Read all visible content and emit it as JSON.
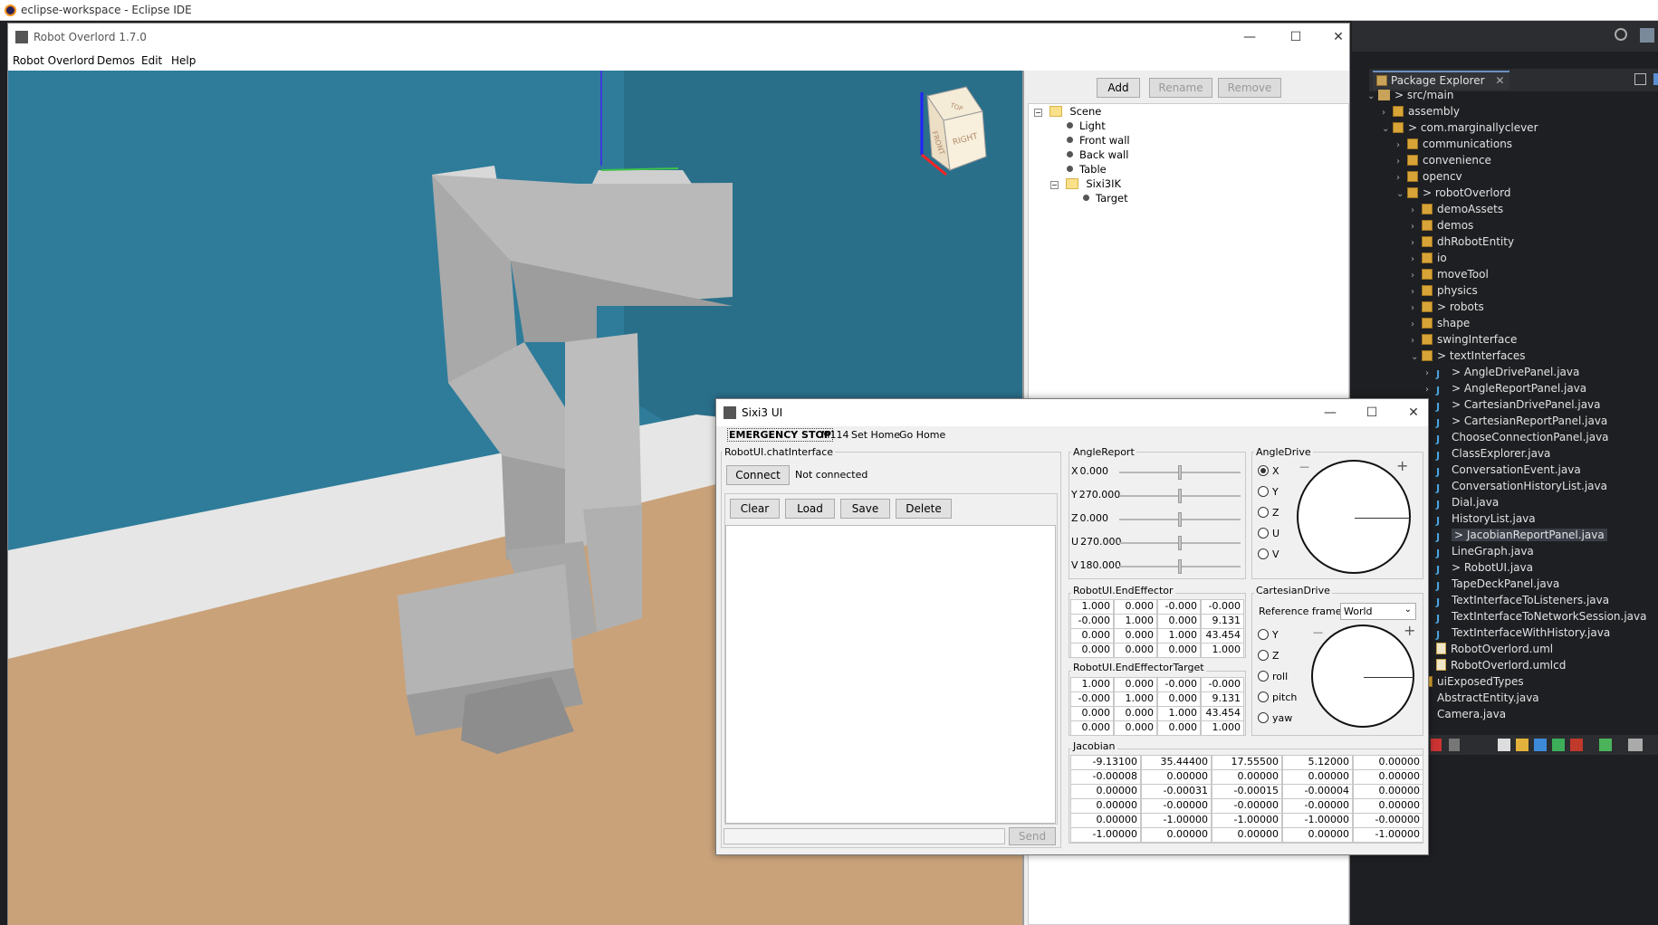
{
  "eclipse": {
    "title": "eclipse-workspace - Eclipse IDE",
    "package_explorer": {
      "tab_label": "Package Explorer",
      "close": "✕",
      "items": [
        {
          "label": "src/main",
          "kind": "fold",
          "depth": 0,
          "arrow": "⌄",
          "prefix": "> "
        },
        {
          "label": "assembly",
          "kind": "pkg",
          "depth": 1,
          "arrow": "›",
          "prefix": ""
        },
        {
          "label": "com.marginallyclever",
          "kind": "pkg",
          "depth": 1,
          "arrow": "⌄",
          "prefix": "> "
        },
        {
          "label": "communications",
          "kind": "pkg",
          "depth": 2,
          "arrow": "›",
          "prefix": ""
        },
        {
          "label": "convenience",
          "kind": "pkg",
          "depth": 2,
          "arrow": "›",
          "prefix": ""
        },
        {
          "label": "opencv",
          "kind": "pkg",
          "depth": 2,
          "arrow": "›",
          "prefix": ""
        },
        {
          "label": "robotOverlord",
          "kind": "pkg",
          "depth": 2,
          "arrow": "⌄",
          "prefix": "> "
        },
        {
          "label": "demoAssets",
          "kind": "pkg",
          "depth": 3,
          "arrow": "›",
          "prefix": ""
        },
        {
          "label": "demos",
          "kind": "pkg",
          "depth": 3,
          "arrow": "›",
          "prefix": ""
        },
        {
          "label": "dhRobotEntity",
          "kind": "pkg",
          "depth": 3,
          "arrow": "›",
          "prefix": ""
        },
        {
          "label": "io",
          "kind": "pkg",
          "depth": 3,
          "arrow": "›",
          "prefix": ""
        },
        {
          "label": "moveTool",
          "kind": "pkg",
          "depth": 3,
          "arrow": "›",
          "prefix": ""
        },
        {
          "label": "physics",
          "kind": "pkg",
          "depth": 3,
          "arrow": "›",
          "prefix": ""
        },
        {
          "label": "robots",
          "kind": "pkg",
          "depth": 3,
          "arrow": "›",
          "prefix": "> "
        },
        {
          "label": "shape",
          "kind": "pkg",
          "depth": 3,
          "arrow": "›",
          "prefix": ""
        },
        {
          "label": "swingInterface",
          "kind": "pkg",
          "depth": 3,
          "arrow": "›",
          "prefix": ""
        },
        {
          "label": "textInterfaces",
          "kind": "pkg",
          "depth": 3,
          "arrow": "⌄",
          "prefix": "> "
        },
        {
          "label": "AngleDrivePanel.java",
          "kind": "java",
          "depth": 4,
          "arrow": "›",
          "prefix": "> "
        },
        {
          "label": "AngleReportPanel.java",
          "kind": "java",
          "depth": 4,
          "arrow": "›",
          "prefix": "> "
        },
        {
          "label": "CartesianDrivePanel.java",
          "kind": "java",
          "depth": 4,
          "arrow": "›",
          "prefix": "> "
        },
        {
          "label": "CartesianReportPanel.java",
          "kind": "java",
          "depth": 4,
          "arrow": "›",
          "prefix": "> "
        },
        {
          "label": "ChooseConnectionPanel.java",
          "kind": "java",
          "depth": 4,
          "arrow": "›",
          "prefix": ""
        },
        {
          "label": "ClassExplorer.java",
          "kind": "java",
          "depth": 4,
          "arrow": "›",
          "prefix": ""
        },
        {
          "label": "ConversationEvent.java",
          "kind": "java",
          "depth": 4,
          "arrow": "›",
          "prefix": ""
        },
        {
          "label": "ConversationHistoryList.java",
          "kind": "java",
          "depth": 4,
          "arrow": "›",
          "prefix": ""
        },
        {
          "label": "Dial.java",
          "kind": "java",
          "depth": 4,
          "arrow": "›",
          "prefix": ""
        },
        {
          "label": "HistoryList.java",
          "kind": "java",
          "depth": 4,
          "arrow": "›",
          "prefix": ""
        },
        {
          "label": "JacobianReportPanel.java",
          "kind": "java",
          "depth": 4,
          "arrow": "›",
          "prefix": "> ",
          "selected": true
        },
        {
          "label": "LineGraph.java",
          "kind": "java",
          "depth": 4,
          "arrow": "›",
          "prefix": ""
        },
        {
          "label": "RobotUI.java",
          "kind": "java",
          "depth": 4,
          "arrow": "›",
          "prefix": "> "
        },
        {
          "label": "TapeDeckPanel.java",
          "kind": "java",
          "depth": 4,
          "arrow": "›",
          "prefix": ""
        },
        {
          "label": "TextInterfaceToListeners.java",
          "kind": "java",
          "depth": 4,
          "arrow": "›",
          "prefix": ""
        },
        {
          "label": "TextInterfaceToNetworkSession.java",
          "kind": "java",
          "depth": 4,
          "arrow": "›",
          "prefix": ""
        },
        {
          "label": "TextInterfaceWithHistory.java",
          "kind": "java",
          "depth": 4,
          "arrow": "›",
          "prefix": ""
        },
        {
          "label": "RobotOverlord.uml",
          "kind": "xml",
          "depth": 4,
          "arrow": "",
          "prefix": ""
        },
        {
          "label": "RobotOverlord.umlcd",
          "kind": "xml",
          "depth": 4,
          "arrow": "",
          "prefix": ""
        },
        {
          "label": "uiExposedTypes",
          "kind": "pkg",
          "depth": 3,
          "arrow": "›",
          "prefix": ""
        },
        {
          "label": "AbstractEntity.java",
          "kind": "java",
          "depth": 3,
          "arrow": "›",
          "prefix": ""
        },
        {
          "label": "Camera.java",
          "kind": "java",
          "depth": 3,
          "arrow": "›",
          "prefix": ""
        }
      ]
    }
  },
  "robot_overlord": {
    "title": "Robot Overlord 1.7.0",
    "menu": [
      "Robot Overlord",
      "Demos",
      "Edit",
      "Help"
    ],
    "win_min": "—",
    "win_max": "☐",
    "win_close": "✕",
    "cube_labels": {
      "top": "TOP",
      "front": "FRONT",
      "right": "RIGHT"
    },
    "scene_buttons": {
      "add": "Add",
      "rename": "Rename",
      "remove": "Remove"
    },
    "scene_tree": {
      "root": "Scene",
      "items": [
        "Light",
        "Front wall",
        "Back wall",
        "Table"
      ],
      "robot": "Sixi3IK",
      "robot_children": [
        "Target"
      ],
      "expander": "−"
    }
  },
  "sixi3": {
    "title": "Sixi3 UI",
    "menu": {
      "estop": "EMERGENCY STOP",
      "m114": "M114",
      "set_home": "Set Home",
      "go_home": "Go Home"
    },
    "chat": {
      "title": "RobotUI.chatInterface",
      "connect": "Connect",
      "status": "Not connected",
      "clear": "Clear",
      "load": "Load",
      "save": "Save",
      "delete": "Delete",
      "input_value": "",
      "send": "Send"
    },
    "angle_report": {
      "title": "AngleReport",
      "rows": [
        {
          "label": "X",
          "value": "0.000",
          "level": 0.5
        },
        {
          "label": "Y",
          "value": "270.000",
          "level": 0.5
        },
        {
          "label": "Z",
          "value": "0.000",
          "level": 0.5
        },
        {
          "label": "U",
          "value": "270.000",
          "level": 0.5
        },
        {
          "label": "V",
          "value": "180.000",
          "level": 0.5
        }
      ]
    },
    "angle_drive": {
      "title": "AngleDrive",
      "options": [
        "X",
        "Y",
        "Z",
        "U",
        "V"
      ],
      "selected": "X",
      "minus": "—",
      "plus": "+"
    },
    "end_effector": {
      "title": "RobotUI.EndEffector",
      "matrix": [
        [
          "1.000",
          "0.000",
          "-0.000",
          "-0.000"
        ],
        [
          "-0.000",
          "1.000",
          "0.000",
          "9.131"
        ],
        [
          "0.000",
          "0.000",
          "1.000",
          "43.454"
        ],
        [
          "0.000",
          "0.000",
          "0.000",
          "1.000"
        ]
      ]
    },
    "end_effector_target": {
      "title": "RobotUI.EndEffectorTarget",
      "matrix": [
        [
          "1.000",
          "0.000",
          "-0.000",
          "-0.000"
        ],
        [
          "-0.000",
          "1.000",
          "0.000",
          "9.131"
        ],
        [
          "0.000",
          "0.000",
          "1.000",
          "43.454"
        ],
        [
          "0.000",
          "0.000",
          "0.000",
          "1.000"
        ]
      ]
    },
    "cartesian_drive": {
      "title": "CartesianDrive",
      "ref_frame_label": "Reference frame",
      "ref_frame_value": "World",
      "options": [
        "Y",
        "Z",
        "roll",
        "pitch",
        "yaw"
      ],
      "minus": "—",
      "plus": "+"
    },
    "jacobian": {
      "title": "Jacobian",
      "matrix": [
        [
          "-9.13100",
          "35.44400",
          "17.55500",
          "5.12000",
          "0.00000"
        ],
        [
          "-0.00008",
          "0.00000",
          "0.00000",
          "0.00000",
          "0.00000"
        ],
        [
          "0.00000",
          "-0.00031",
          "-0.00015",
          "-0.00004",
          "0.00000"
        ],
        [
          "0.00000",
          "-0.00000",
          "-0.00000",
          "-0.00000",
          "0.00000"
        ],
        [
          "0.00000",
          "-1.00000",
          "-1.00000",
          "-1.00000",
          "-0.00000"
        ],
        [
          "-1.00000",
          "0.00000",
          "0.00000",
          "0.00000",
          "-1.00000"
        ]
      ]
    }
  },
  "colors": {
    "wall": "#2e7c9a",
    "floor": "#c9a27a",
    "eclipse_bg": "#1e1f22"
  }
}
